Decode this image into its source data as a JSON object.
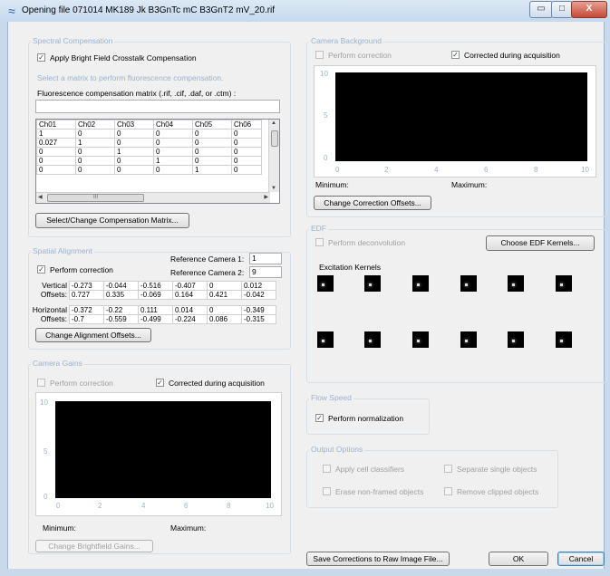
{
  "window": {
    "title": "Opening file 071014 MK189 Jk B3GnTc mC B3GnT2 mV_20.rif",
    "min_glyph": "▭",
    "max_glyph": "□",
    "close_glyph": "X"
  },
  "spectral": {
    "group_label": "Spectral Compensation",
    "bf_crosstalk_label": "Apply Bright Field Crosstalk Compensation",
    "bf_crosstalk_checked": true,
    "hint": "Select a matrix to perform fluorescence compensation.",
    "matrix_label": "Fluorescence compensation matrix (.rif, .cif, .daf, or .ctm) :",
    "matrix_value": "",
    "columns": [
      "Ch01",
      "Ch02",
      "Ch03",
      "Ch04",
      "Ch05",
      "Ch06"
    ],
    "rows": [
      [
        "1",
        "0",
        "0",
        "0",
        "0",
        "0"
      ],
      [
        "0.027",
        "1",
        "0",
        "0",
        "0",
        "0"
      ],
      [
        "0",
        "0",
        "1",
        "0",
        "0",
        "0"
      ],
      [
        "0",
        "0",
        "0",
        "1",
        "0",
        "0"
      ],
      [
        "0",
        "0",
        "0",
        "0",
        "1",
        "0"
      ]
    ],
    "hscroll_glyph": "III",
    "change_matrix_button": "Select/Change Compensation Matrix..."
  },
  "spatial": {
    "group_label": "Spatial Alignment",
    "perform_label": "Perform correction",
    "perform_checked": true,
    "ref_cam1_label": "Reference Camera 1:",
    "ref_cam1_value": "1",
    "ref_cam2_label": "Reference Camera 2:",
    "ref_cam2_value": "9",
    "vertical_label": "Vertical",
    "horizontal_label": "Horizontal",
    "offsets_label": "Offsets:",
    "vertical_rows": [
      [
        "-0.273",
        "-0.044",
        "-0.516",
        "-0.407",
        "0",
        "0.012"
      ],
      [
        "0.727",
        "0.335",
        "-0.069",
        "0.164",
        "0.421",
        "-0.042"
      ]
    ],
    "horizontal_rows": [
      [
        "-0.372",
        "-0.22",
        "0.111",
        "0.014",
        "0",
        "-0.349"
      ],
      [
        "-0.7",
        "-0.559",
        "-0.499",
        "-0.224",
        "0.086",
        "-0.315"
      ]
    ],
    "change_offsets_button": "Change Alignment Offsets..."
  },
  "gains": {
    "group_label": "Camera Gains",
    "perform_label": "Perform correction",
    "perform_checked": false,
    "during_acq_label": "Corrected during acquisition",
    "during_acq_checked": true,
    "y_ticks": [
      "10",
      "5",
      "0"
    ],
    "x_ticks": [
      "0",
      "2",
      "4",
      "6",
      "8",
      "10"
    ],
    "min_label": "Minimum:",
    "max_label": "Maximum:",
    "change_button": "Change Brightfield Gains..."
  },
  "background": {
    "group_label": "Camera Background",
    "perform_label": "Perform correction",
    "perform_checked": false,
    "during_acq_label": "Corrected during acquisition",
    "during_acq_checked": true,
    "y_ticks": [
      "10",
      "5",
      "0"
    ],
    "x_ticks": [
      "0",
      "2",
      "4",
      "6",
      "8",
      "10"
    ],
    "min_label": "Minimum:",
    "max_label": "Maximum:",
    "change_button": "Change Correction Offsets..."
  },
  "edf": {
    "group_label": "EDF",
    "perform_label": "Perform deconvolution",
    "perform_checked": false,
    "choose_button": "Choose EDF Kernels...",
    "kernels_label": "Excitation Kernels"
  },
  "flow": {
    "group_label": "Flow Speed",
    "normalize_label": "Perform normalization",
    "normalize_checked": true
  },
  "output": {
    "group_label": "Output Options",
    "apply_classifiers": "Apply cell classifiers",
    "separate_single": "Separate single objects",
    "erase_nonframed": "Erase non-framed objects",
    "remove_clipped": "Remove clipped objects"
  },
  "footer": {
    "save_button": "Save Corrections to Raw Image File...",
    "ok_button": "OK",
    "cancel_button": "Cancel"
  },
  "check_glyph": "✓"
}
